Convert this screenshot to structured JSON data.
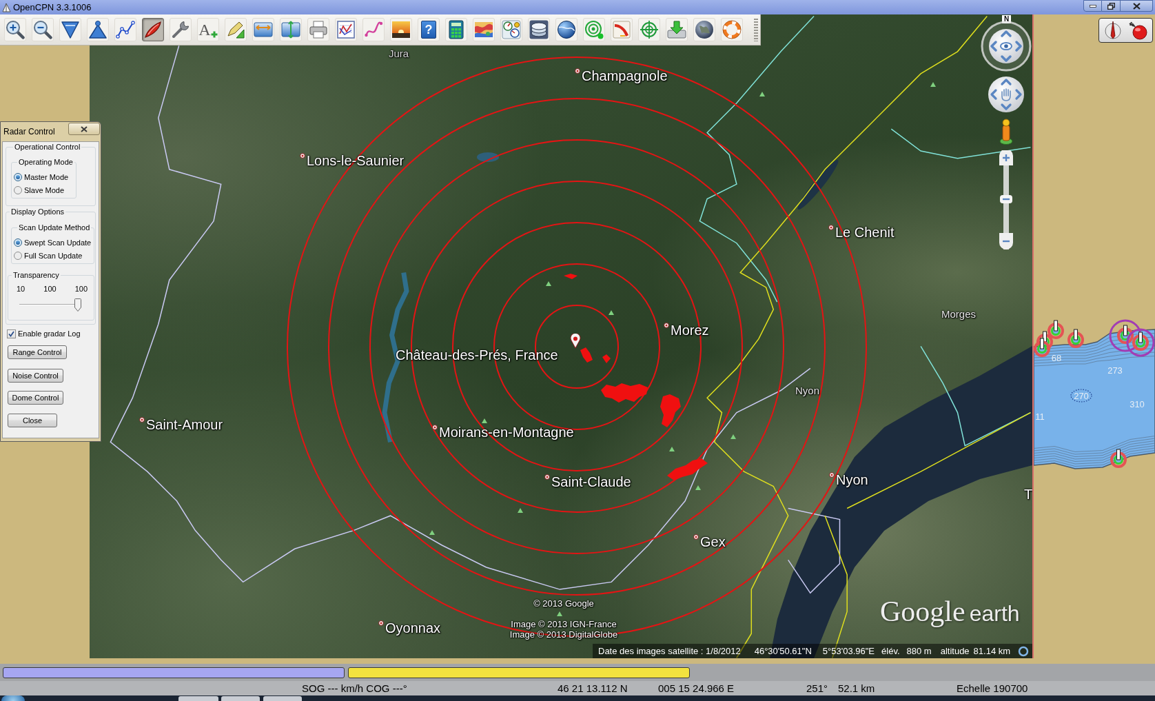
{
  "window": {
    "title": "OpenCPN 3.3.1006"
  },
  "toolbar": {
    "tools": [
      {
        "kind": "zoomin",
        "selected": false
      },
      {
        "kind": "zoomout",
        "selected": false
      },
      {
        "kind": "scaledown",
        "selected": false
      },
      {
        "kind": "scaleup",
        "selected": false
      },
      {
        "kind": "route",
        "selected": false
      },
      {
        "kind": "boat",
        "selected": true
      },
      {
        "kind": "wrench",
        "selected": false
      },
      {
        "kind": "text",
        "glyph": "A",
        "selected": false
      },
      {
        "kind": "measure",
        "selected": false
      },
      {
        "kind": "hsplit",
        "selected": false
      },
      {
        "kind": "vsplit",
        "selected": false
      },
      {
        "kind": "printer",
        "selected": false
      },
      {
        "kind": "routes",
        "selected": false
      },
      {
        "kind": "track",
        "selected": false
      },
      {
        "kind": "sunset",
        "selected": false
      },
      {
        "kind": "help",
        "glyph": "?",
        "selected": false
      },
      {
        "kind": "calculator",
        "selected": false
      },
      {
        "kind": "weather",
        "selected": false
      },
      {
        "kind": "dashboard",
        "selected": false
      },
      {
        "kind": "kap",
        "selected": false
      },
      {
        "kind": "globe",
        "selected": false
      },
      {
        "kind": "radar",
        "selected": false
      },
      {
        "kind": "tide",
        "selected": false
      },
      {
        "kind": "target",
        "selected": false
      },
      {
        "kind": "download",
        "selected": false
      },
      {
        "kind": "earth",
        "selected": false
      },
      {
        "kind": "lifebuoy",
        "selected": false
      }
    ]
  },
  "map": {
    "places": [
      {
        "name": "Jura",
        "kind": "region"
      },
      {
        "name": "Champagnole",
        "kind": "town"
      },
      {
        "name": "Lons-le-Saunier",
        "kind": "town"
      },
      {
        "name": "Le Chenit",
        "kind": "town"
      },
      {
        "name": "Morges",
        "kind": "minor"
      },
      {
        "name": "Morez",
        "kind": "town"
      },
      {
        "name": "Château-des-Prés, France",
        "kind": "area"
      },
      {
        "name": "Nyon",
        "kind": "minor"
      },
      {
        "name": "Saint-Amour",
        "kind": "town"
      },
      {
        "name": "Moirans-en-Montagne",
        "kind": "town"
      },
      {
        "name": "Saint-Claude",
        "kind": "town"
      },
      {
        "name": "Nyon",
        "kind": "town"
      },
      {
        "name": "Gex",
        "kind": "town"
      },
      {
        "name": "T",
        "kind": "edge"
      },
      {
        "name": "Oyonnax",
        "kind": "town"
      }
    ],
    "north_label": "N",
    "zoom_slider": {
      "level": 0.5
    },
    "attribution": [
      "© 2013 Google",
      "Image © 2013 IGN-France",
      "Image © 2013 DigitalGlobe"
    ],
    "logo": {
      "brand": "Google",
      "product": "earth"
    },
    "info_bar": {
      "imagery_date": "Date des images satellite : 1/8/2012",
      "latitude": "46°30'50.61\"N",
      "longitude": "5°53'03.96\"E",
      "elevation_label": "élév.",
      "elevation": "880 m",
      "altitude_label": "altitude",
      "altitude": "81.14 km"
    }
  },
  "chart": {
    "soundings": [
      "68",
      "273",
      "270",
      "310",
      "11"
    ]
  },
  "radar_control": {
    "title": "Radar Control",
    "operational_control": {
      "label": "Operational Control",
      "operating_mode": {
        "label": "Operating Mode",
        "options": [
          {
            "label": "Master Mode",
            "selected": true
          },
          {
            "label": "Slave Mode",
            "selected": false
          }
        ]
      }
    },
    "display_options": {
      "label": "Display Options",
      "scan_update_method": {
        "label": "Scan Update Method",
        "options": [
          {
            "label": "Swept Scan Update",
            "selected": true
          },
          {
            "label": "Full Scan Update",
            "selected": false
          }
        ]
      },
      "transparency": {
        "label": "Transparency",
        "min_label": "10",
        "value_label": "100",
        "max_label": "100",
        "level": 1
      }
    },
    "log_checkbox": {
      "label": "Enable gradar Log",
      "checked": true
    },
    "buttons": [
      "Range Control",
      "Noise Control",
      "Dome Control",
      "Close"
    ]
  },
  "chart_bar": {
    "keys": [
      {
        "color": "#a6a6f2"
      },
      {
        "color": "#f2e23e"
      }
    ]
  },
  "status_bar": {
    "sog_cog": "SOG --- km/h COG ---°",
    "latitude": "46 21 13.112 N",
    "longitude": "005 15 24.966 E",
    "bearing": "251°",
    "distance": "52.1 km",
    "scale": "Echelle 190700"
  }
}
